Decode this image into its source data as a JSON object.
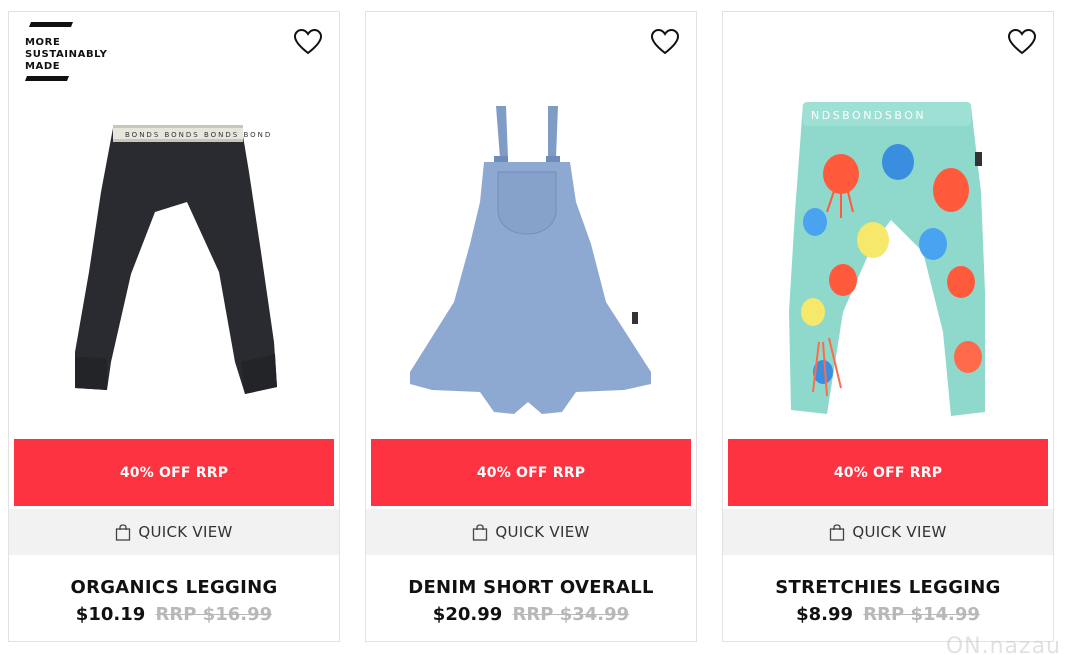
{
  "products": [
    {
      "badge_lines": [
        "MORE",
        "SUSTAINABLY",
        "MADE"
      ],
      "promo": "40% OFF RRP",
      "quick_view": "QUICK VIEW",
      "name": "ORGANICS LEGGING",
      "price": "$10.19",
      "rrp": "RRP $16.99",
      "image_icon": "charcoal-leggings-image"
    },
    {
      "promo": "40% OFF RRP",
      "quick_view": "QUICK VIEW",
      "name": "DENIM SHORT OVERALL",
      "price": "$20.99",
      "rrp": "RRP $34.99",
      "image_icon": "denim-overall-image"
    },
    {
      "promo": "40% OFF RRP",
      "quick_view": "QUICK VIEW",
      "name": "STRETCHIES LEGGING",
      "price": "$8.99",
      "rrp": "RRP $14.99",
      "image_icon": "jellyfish-leggings-image"
    }
  ],
  "watermark": "ON.nazau",
  "colors": {
    "promo": "#fe3341",
    "quickview_bg": "#f2f2f2",
    "strike": "#b8b8b8"
  }
}
